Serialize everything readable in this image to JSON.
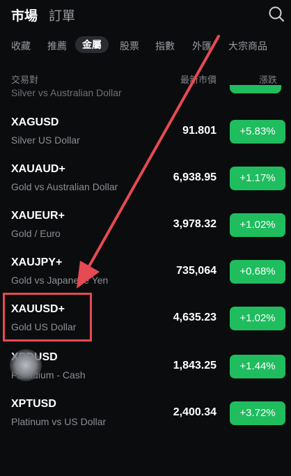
{
  "header": {
    "tabs": [
      {
        "label": "市場"
      },
      {
        "label": "訂單"
      }
    ]
  },
  "categories": [
    {
      "label": "收藏"
    },
    {
      "label": "推薦"
    },
    {
      "label": "金屬"
    },
    {
      "label": "股票"
    },
    {
      "label": "指數"
    },
    {
      "label": "外匯"
    },
    {
      "label": "大宗商品"
    }
  ],
  "active_category": "金屬",
  "columns": {
    "pair": "交易對",
    "price": "最新市價",
    "change": "漲跌"
  },
  "partial_row": {
    "desc": "Silver vs Australian Dollar"
  },
  "rows": [
    {
      "symbol": "XAGUSD",
      "desc": "Silver US Dollar",
      "price": "91.801",
      "change": "+5.83%"
    },
    {
      "symbol": "XAUAUD+",
      "desc": "Gold vs Australian Dollar",
      "price": "6,938.95",
      "change": "+1.17%"
    },
    {
      "symbol": "XAUEUR+",
      "desc": "Gold / Euro",
      "price": "3,978.32",
      "change": "+1.02%"
    },
    {
      "symbol": "XAUJPY+",
      "desc": "Gold vs Japanese Yen",
      "price": "735,064",
      "change": "+0.68%"
    },
    {
      "symbol": "XAUUSD+",
      "desc": "Gold US Dollar",
      "price": "4,635.23",
      "change": "+1.02%"
    },
    {
      "symbol": "XPDUSD",
      "desc": "Palladium - Cash",
      "price": "1,843.25",
      "change": "+1.44%"
    },
    {
      "symbol": "XPTUSD",
      "desc": "Platinum vs US Dollar",
      "price": "2,400.34",
      "change": "+3.72%"
    }
  ],
  "colors": {
    "up": "#1fbd5e",
    "highlight": "#e74a52",
    "background": "#0b0c0e"
  },
  "icons": {
    "search": "search-icon",
    "assistive_touch": "floating-button"
  }
}
